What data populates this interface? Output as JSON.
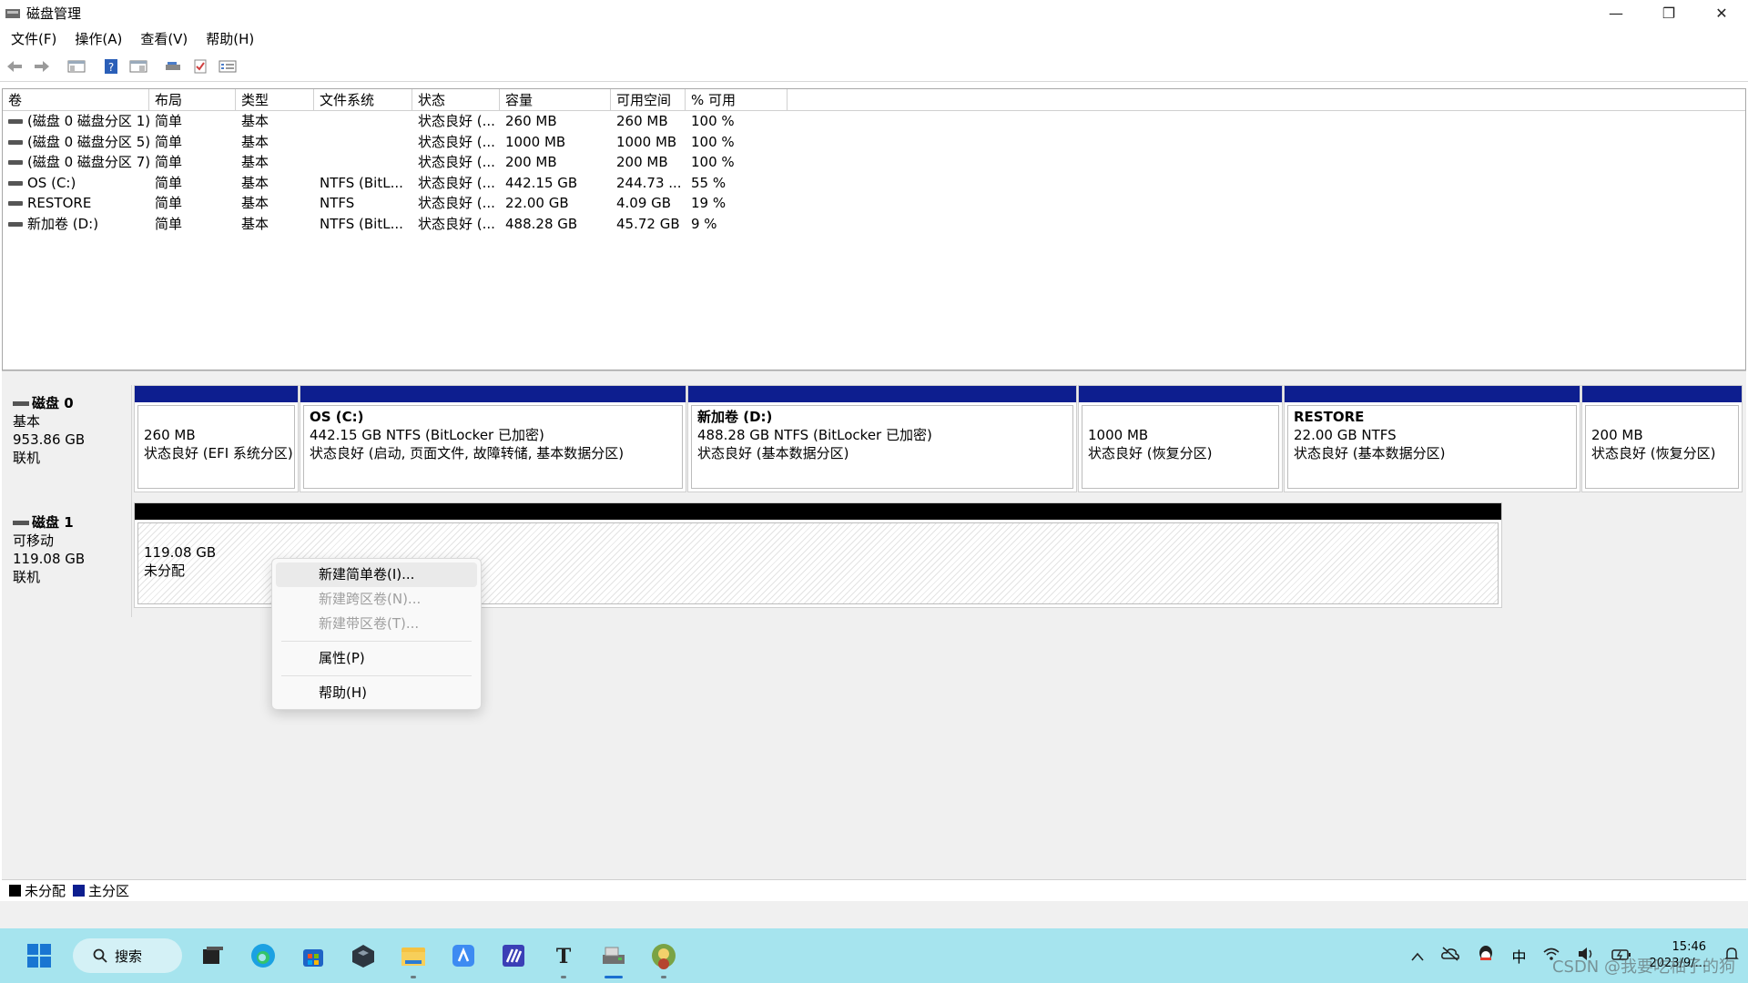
{
  "window": {
    "title": "磁盘管理",
    "minimize": "—",
    "restore": "❐",
    "close": "✕"
  },
  "menu": [
    "文件(F)",
    "操作(A)",
    "查看(V)",
    "帮助(H)"
  ],
  "toolbar": [
    "back-icon",
    "forward-icon",
    "console-tree-icon",
    "help-icon",
    "panel-icon",
    "disk-icon",
    "check-icon",
    "list-icon"
  ],
  "table": {
    "headers": [
      "卷",
      "布局",
      "类型",
      "文件系统",
      "状态",
      "容量",
      "可用空间",
      "% 可用"
    ],
    "rows": [
      [
        "(磁盘 0 磁盘分区 1)",
        "简单",
        "基本",
        "",
        "状态良好 (...",
        "260 MB",
        "260 MB",
        "100 %"
      ],
      [
        "(磁盘 0 磁盘分区 5)",
        "简单",
        "基本",
        "",
        "状态良好 (...",
        "1000 MB",
        "1000 MB",
        "100 %"
      ],
      [
        "(磁盘 0 磁盘分区 7)",
        "简单",
        "基本",
        "",
        "状态良好 (...",
        "200 MB",
        "200 MB",
        "100 %"
      ],
      [
        "OS (C:)",
        "简单",
        "基本",
        "NTFS (BitL...",
        "状态良好 (...",
        "442.15 GB",
        "244.73 ...",
        "55 %"
      ],
      [
        "RESTORE",
        "简单",
        "基本",
        "NTFS",
        "状态良好 (...",
        "22.00 GB",
        "4.09 GB",
        "19 %"
      ],
      [
        "新加卷 (D:)",
        "简单",
        "基本",
        "NTFS (BitL...",
        "状态良好 (...",
        "488.28 GB",
        "45.72 GB",
        "9 %"
      ]
    ]
  },
  "disk0": {
    "name": "磁盘 0",
    "type": "基本",
    "size": "953.86 GB",
    "status": "联机",
    "partitions": [
      {
        "name": "",
        "line1": "260 MB",
        "line2": "状态良好 (EFI 系统分区)"
      },
      {
        "name": "OS  (C:)",
        "line1": "442.15 GB NTFS (BitLocker 已加密)",
        "line2": "状态良好 (启动, 页面文件, 故障转储, 基本数据分区)"
      },
      {
        "name": "新加卷  (D:)",
        "line1": "488.28 GB NTFS (BitLocker 已加密)",
        "line2": "状态良好 (基本数据分区)"
      },
      {
        "name": "",
        "line1": "1000 MB",
        "line2": "状态良好 (恢复分区)"
      },
      {
        "name": "RESTORE",
        "line1": "22.00 GB NTFS",
        "line2": "状态良好 (基本数据分区)"
      },
      {
        "name": "",
        "line1": "200 MB",
        "line2": "状态良好 (恢复分区)"
      }
    ]
  },
  "disk1": {
    "name": "磁盘 1",
    "type": "可移动",
    "size": "119.08 GB",
    "status": "联机",
    "unallocated": {
      "line1": "119.08 GB",
      "line2": "未分配"
    }
  },
  "context_menu": {
    "new_simple": "新建简单卷(I)...",
    "new_spanned": "新建跨区卷(N)...",
    "new_striped": "新建带区卷(T)...",
    "properties": "属性(P)",
    "help": "帮助(H)"
  },
  "legend": {
    "unallocated": "未分配",
    "primary": "主分区",
    "colors": {
      "unallocated": "#000000",
      "primary": "#0d1e8f"
    }
  },
  "taskbar": {
    "search": "搜索",
    "tray_ime": "中",
    "time": "15:46",
    "date": "2023/9/..."
  },
  "watermark": "CSDN @我要吃柚子的狗"
}
